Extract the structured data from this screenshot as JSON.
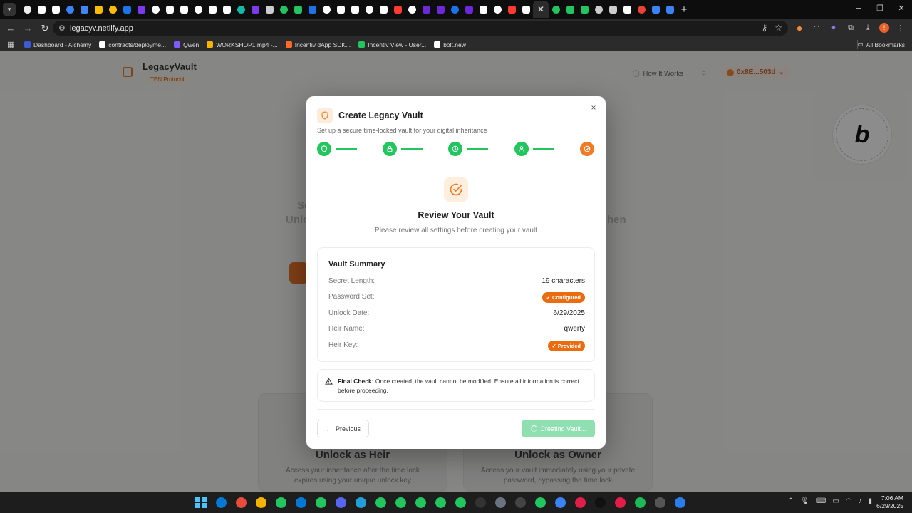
{
  "browser": {
    "url": "legacyv.netlify.app",
    "bookmarks": [
      {
        "label": "Dashboard - Alchemy",
        "color": "#3b5bdb"
      },
      {
        "label": "contracts/deployme...",
        "color": "#ffffff"
      },
      {
        "label": "Qwen",
        "color": "#7c5cff"
      },
      {
        "label": "WORKSHOP1.mp4 -...",
        "color": "#f4b400"
      },
      {
        "label": "Incentiv dApp SDK...",
        "color": "#ff6a2b"
      },
      {
        "label": "Incentiv View - User...",
        "color": "#22c55e"
      },
      {
        "label": "bolt.new",
        "color": "#ffffff"
      }
    ],
    "all_bookmarks": "All Bookmarks",
    "tab_colors": [
      "#eeeeee",
      "#ffffff",
      "#ffffff",
      "#3b82f6",
      "#4285f4",
      "#fbbc04",
      "#fbbc04",
      "#1a73e8",
      "#7c3aed",
      "#ffffff",
      "#ffffff",
      "#ffffff",
      "#ffffff",
      "#ffffff",
      "#ffffff",
      "#14b8a6",
      "#7c3aed",
      "#cccccc",
      "#22c55e",
      "#22c55e",
      "#1a73e8",
      "#ffffff",
      "#ffffff",
      "#ffffff",
      "#ffffff",
      "#ffffff",
      "#ff3b30",
      "#ffffff",
      "#6d28d9",
      "#6d28d9",
      "#1a73e8",
      "#6d28d9",
      "#ffffff",
      "#ffffff",
      "#ff3b30",
      "#ffffff",
      "#22c55e",
      "#22c55e",
      "#22c55e",
      "#cccccc",
      "#cccccc",
      "#ffffff",
      "#ea4335",
      "#3b82f6",
      "#3b82f6"
    ]
  },
  "app": {
    "brand": "LegacyVault",
    "brand_sub": "TEN Protocol",
    "how_it_works": "How It Works",
    "wallet": "0x8E...503d",
    "bg_cards": [
      {
        "heading": "Unlock as Heir",
        "desc": "Access your inheritance after the time lock expires using your unique unlock key"
      },
      {
        "heading": "Unlock as Owner",
        "desc": "Access your vault immediately using your private password, bypassing the time lock"
      }
    ],
    "bg_fragments": [
      "Se",
      "Unlo",
      "",
      "hen"
    ]
  },
  "modal": {
    "title": "Create Legacy Vault",
    "subtitle": "Set up a secure time-locked vault for your digital inheritance",
    "close": "×",
    "review_title": "Review Your Vault",
    "review_subtitle": "Please review all settings before creating your vault",
    "summary": {
      "title": "Vault Summary",
      "rows": [
        {
          "label": "Secret Length:",
          "value": "19 characters",
          "type": "text"
        },
        {
          "label": "Password Set:",
          "value": "✓ Configured",
          "type": "badge"
        },
        {
          "label": "Unlock Date:",
          "value": "6/29/2025",
          "type": "text"
        },
        {
          "label": "Heir Name:",
          "value": "qwerty",
          "type": "text"
        },
        {
          "label": "Heir Key:",
          "value": "✓ Provided",
          "type": "badge"
        }
      ]
    },
    "final_check": {
      "label": "Final Check:",
      "text": " Once created, the vault cannot be modified. Ensure all information is correct before proceeding."
    },
    "prev_button": "Previous",
    "create_button": "Creating Vault..."
  },
  "colors": {
    "accent": "#ef7b24",
    "success": "#22c55e",
    "badge": "#ea6c0e"
  },
  "taskbar": {
    "time": "7:06 AM",
    "date": "6/29/2025",
    "apps": [
      "#0078d4",
      "#e74c3c",
      "#f4b400",
      "#22c55e",
      "#0078d4",
      "#22c55e",
      "#5865f2",
      "#229ed9",
      "#22c55e",
      "#22c55e",
      "#22c55e",
      "#22c55e",
      "#22c55e",
      "#333333",
      "#6b7280",
      "#444444",
      "#22c55e",
      "#3b82f6",
      "#e11d48",
      "#111111",
      "#e11d48",
      "#1db954",
      "#555555",
      "#2b7de9"
    ]
  }
}
